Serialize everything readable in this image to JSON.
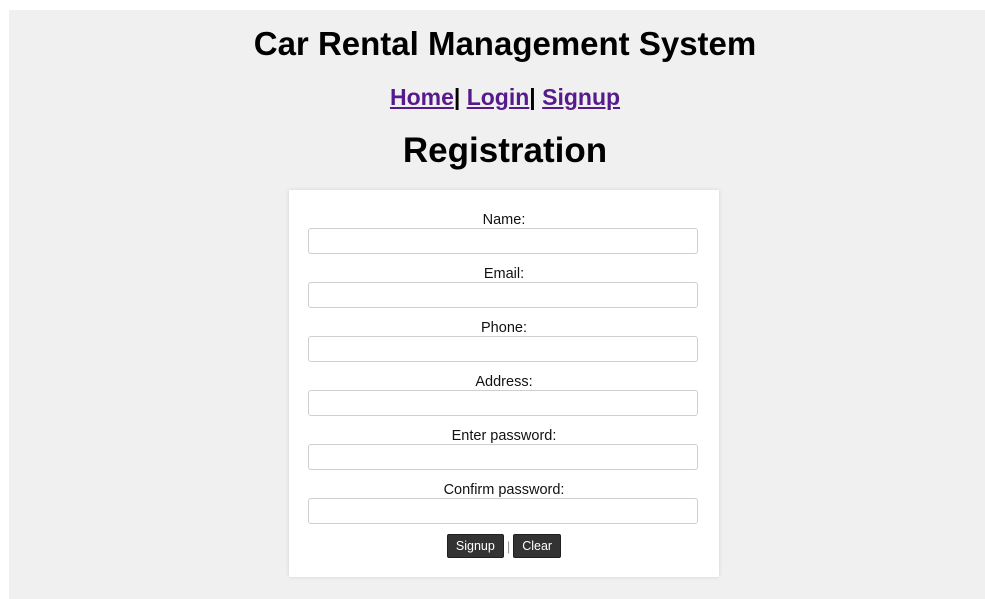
{
  "site": {
    "title": "Car Rental Management System"
  },
  "nav": {
    "items": [
      {
        "label": "Home"
      },
      {
        "label": "Login"
      },
      {
        "label": "Signup"
      }
    ],
    "separator": "|"
  },
  "page": {
    "heading": "Registration"
  },
  "form": {
    "fields": [
      {
        "label": "Name:",
        "value": ""
      },
      {
        "label": "Email:",
        "value": ""
      },
      {
        "label": "Phone:",
        "value": ""
      },
      {
        "label": "Address:",
        "value": ""
      },
      {
        "label": "Enter password:",
        "value": ""
      },
      {
        "label": "Confirm password:",
        "value": ""
      }
    ],
    "signup_label": "Signup",
    "separator": "|",
    "clear_label": "Clear"
  },
  "colors": {
    "page_background": "#f0f0f0",
    "card_background": "#ffffff",
    "link": "#551a8b",
    "button": "#333333"
  }
}
